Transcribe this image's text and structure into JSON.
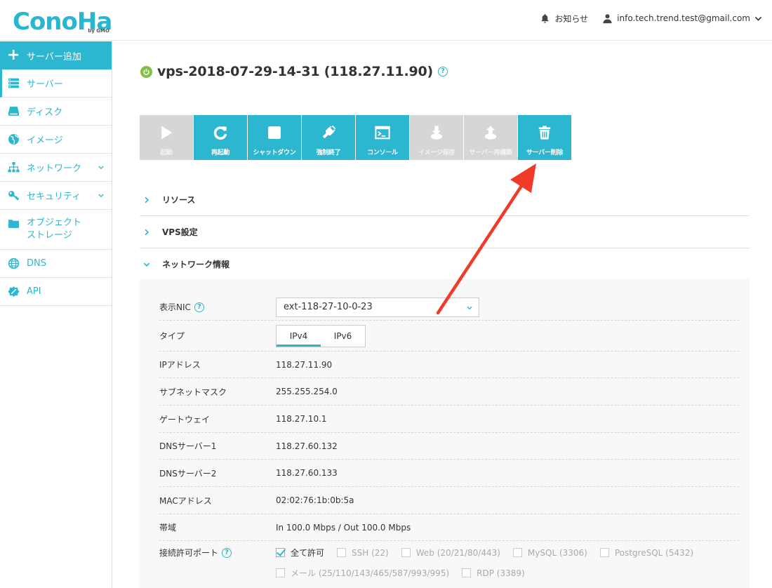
{
  "header": {
    "logo_text": "ConoHa",
    "logo_sub": "by GMO",
    "notifications_label": "お知らせ",
    "user_email": "info.tech.trend.test@gmail.com"
  },
  "sidebar": {
    "add_server_label": "サーバー追加",
    "items": [
      {
        "label": "サーバー"
      },
      {
        "label": "ディスク"
      },
      {
        "label": "イメージ"
      },
      {
        "label": "ネットワーク"
      },
      {
        "label": "セキュリティ"
      },
      {
        "label": "オブジェクトストレージ",
        "line1": "オブジェクト",
        "line2": "ストレージ"
      },
      {
        "label": "DNS"
      },
      {
        "label": "API"
      }
    ]
  },
  "server": {
    "title": "vps-2018-07-29-14-31 (118.27.11.90)",
    "status_color": "#7dc242"
  },
  "toolbar": {
    "buttons": [
      {
        "label": "起動",
        "enabled": false
      },
      {
        "label": "再起動",
        "enabled": true
      },
      {
        "label": "シャットダウン",
        "enabled": true
      },
      {
        "label": "強制終了",
        "enabled": true
      },
      {
        "label": "コンソール",
        "enabled": true
      },
      {
        "label": "イメージ保存",
        "enabled": false
      },
      {
        "label": "サーバー再構築",
        "enabled": false
      },
      {
        "label": "サーバー削除",
        "enabled": true
      }
    ]
  },
  "sections": [
    {
      "label": "リソース",
      "expanded": false
    },
    {
      "label": "VPS設定",
      "expanded": false
    },
    {
      "label": "ネットワーク情報",
      "expanded": true
    }
  ],
  "network": {
    "nic_label": "表示NIC",
    "nic_value": "ext-118-27-10-0-23",
    "type_label": "タイプ",
    "type_tabs": [
      "IPv4",
      "IPv6"
    ],
    "rows": [
      {
        "label": "IPアドレス",
        "value": "118.27.11.90"
      },
      {
        "label": "サブネットマスク",
        "value": "255.255.254.0"
      },
      {
        "label": "ゲートウェイ",
        "value": "118.27.10.1"
      },
      {
        "label": "DNSサーバー1",
        "value": "118.27.60.132"
      },
      {
        "label": "DNSサーバー2",
        "value": "118.27.60.133"
      },
      {
        "label": "MACアドレス",
        "value": "02:02:76:1b:0b:5a"
      },
      {
        "label": "帯域",
        "value": "In 100.0 Mbps / Out 100.0 Mbps"
      }
    ],
    "ports_label": "接続許可ポート",
    "ports": [
      {
        "label": "全て許可",
        "checked": true
      },
      {
        "label": "SSH (22)",
        "checked": false
      },
      {
        "label": "Web (20/21/80/443)",
        "checked": false
      },
      {
        "label": "MySQL (3306)",
        "checked": false
      },
      {
        "label": "PostgreSQL (5432)",
        "checked": false
      },
      {
        "label": "メール (25/110/143/465/587/993/995)",
        "checked": false
      },
      {
        "label": "RDP (3389)",
        "checked": false
      }
    ]
  },
  "colors": {
    "accent": "#2cb6d0",
    "disabled": "#d6d6d6",
    "annotation": "#f03a2a"
  }
}
